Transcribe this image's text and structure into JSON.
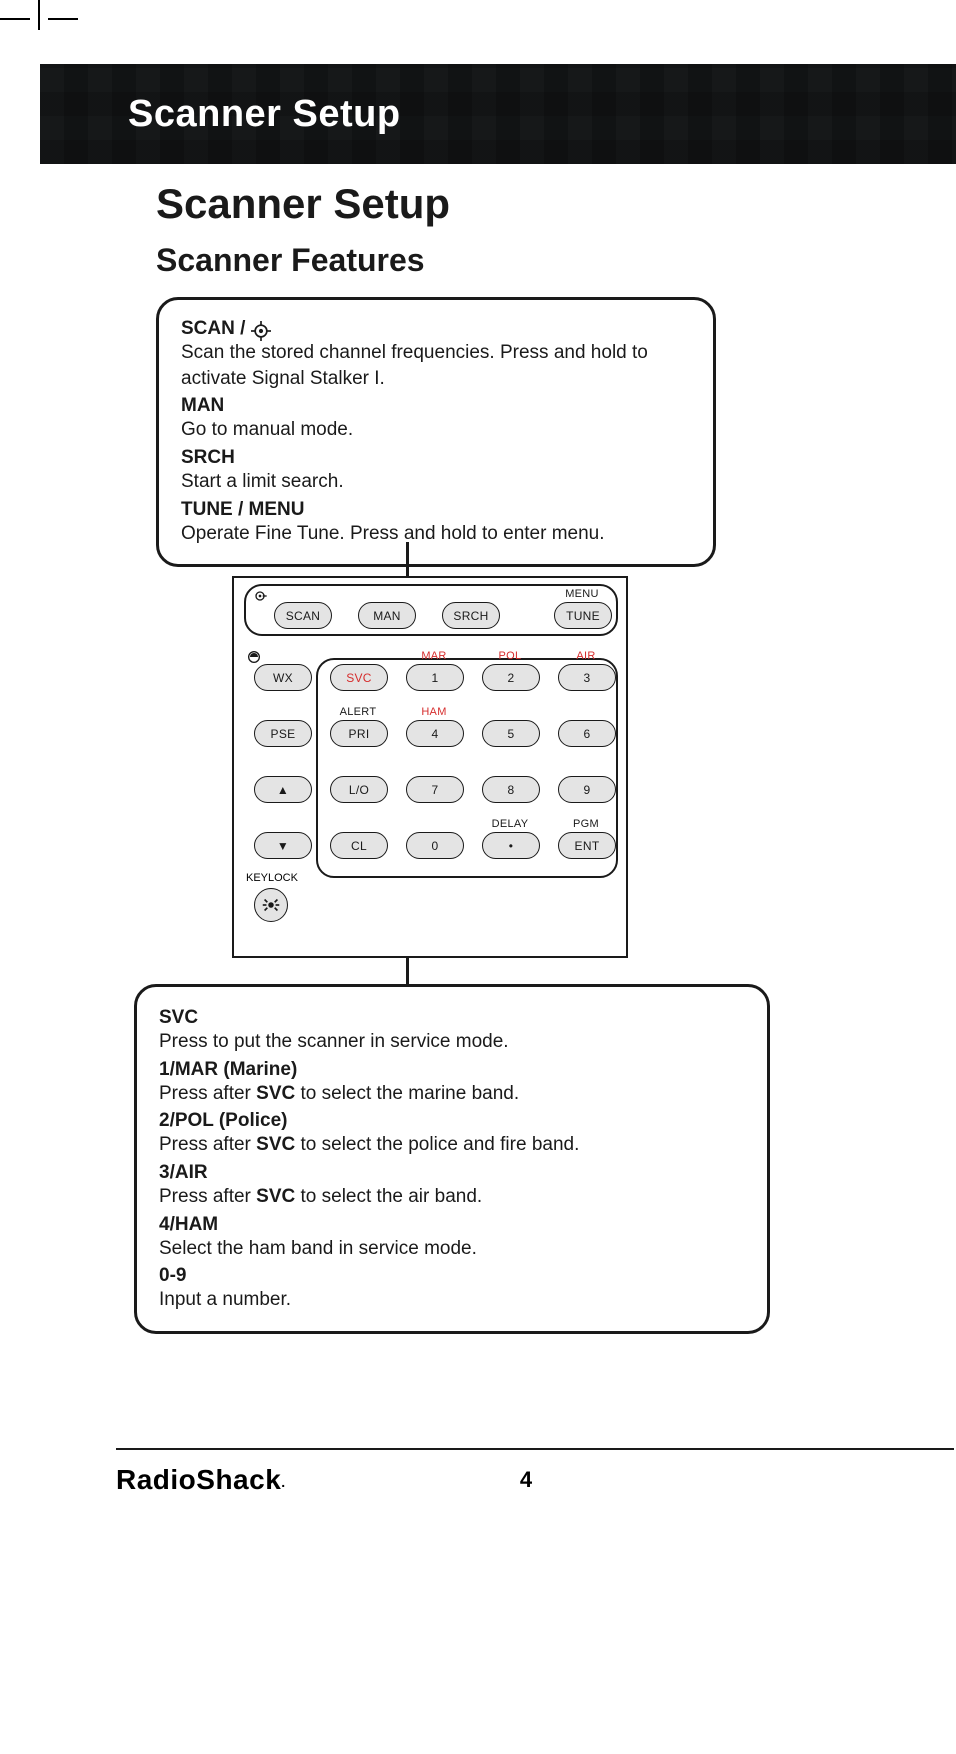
{
  "header": {
    "section": "Scanner Setup"
  },
  "title": "Scanner Setup",
  "subtitle": "Scanner Features",
  "callout_top": [
    {
      "label": "SCAN / ",
      "desc": "Scan the stored channel frequencies. Press and hold to activate Signal Stalker I.",
      "has_icon": true
    },
    {
      "label": "MAN",
      "desc": "Go to manual mode."
    },
    {
      "label": "SRCH",
      "desc": "Start a limit search."
    },
    {
      "label": "TUNE / MENU",
      "desc": "Operate Fine Tune. Press and hold to enter menu."
    }
  ],
  "keypad": {
    "row1": [
      {
        "name": "scan",
        "label": "SCAN"
      },
      {
        "name": "man",
        "label": "MAN"
      },
      {
        "name": "srch",
        "label": "SRCH"
      },
      {
        "name": "tune",
        "label": "TUNE",
        "super": "MENU"
      }
    ],
    "row2": [
      {
        "name": "wx",
        "label": "WX"
      },
      {
        "name": "svc",
        "label": "SVC",
        "red": true
      },
      {
        "name": "n1",
        "label": "1",
        "super": "MAR",
        "super_red": true
      },
      {
        "name": "n2",
        "label": "2",
        "super": "POL",
        "super_red": true
      },
      {
        "name": "n3",
        "label": "3",
        "super": "AIR",
        "super_red": true
      }
    ],
    "row3": [
      {
        "name": "pse",
        "label": "PSE"
      },
      {
        "name": "pri",
        "label": "PRI",
        "super": "ALERT"
      },
      {
        "name": "n4",
        "label": "4",
        "super": "HAM",
        "super_red": true
      },
      {
        "name": "n5",
        "label": "5"
      },
      {
        "name": "n6",
        "label": "6"
      }
    ],
    "row4": [
      {
        "name": "up",
        "label": "▲"
      },
      {
        "name": "lo",
        "label": "L/O"
      },
      {
        "name": "n7",
        "label": "7"
      },
      {
        "name": "n8",
        "label": "8"
      },
      {
        "name": "n9",
        "label": "9"
      }
    ],
    "row5": [
      {
        "name": "down",
        "label": "▼"
      },
      {
        "name": "cl",
        "label": "CL"
      },
      {
        "name": "n0",
        "label": "0"
      },
      {
        "name": "dot",
        "label": "•",
        "super": "DELAY"
      },
      {
        "name": "ent",
        "label": "ENT",
        "super": "PGM"
      }
    ],
    "keylock_label": "KEYLOCK"
  },
  "callout_bottom": [
    {
      "label": "SVC",
      "desc": "Press to put the scanner in service mode."
    },
    {
      "label": "1/MAR (Marine)",
      "desc": "Press after SVC to select the marine band.",
      "bold_word": "SVC"
    },
    {
      "label": "2/POL (Police)",
      "desc": "Press after SVC to select the police and fire band.",
      "bold_word": "SVC"
    },
    {
      "label": "3/AIR",
      "desc": "Press after SVC to select the air band.",
      "bold_word": "SVC"
    },
    {
      "label": "4/HAM",
      "desc": "Select the ham band in service mode."
    },
    {
      "label": "0-9",
      "desc": "Input a number."
    }
  ],
  "footer": {
    "brand": "RadioShack",
    "page": "4"
  }
}
